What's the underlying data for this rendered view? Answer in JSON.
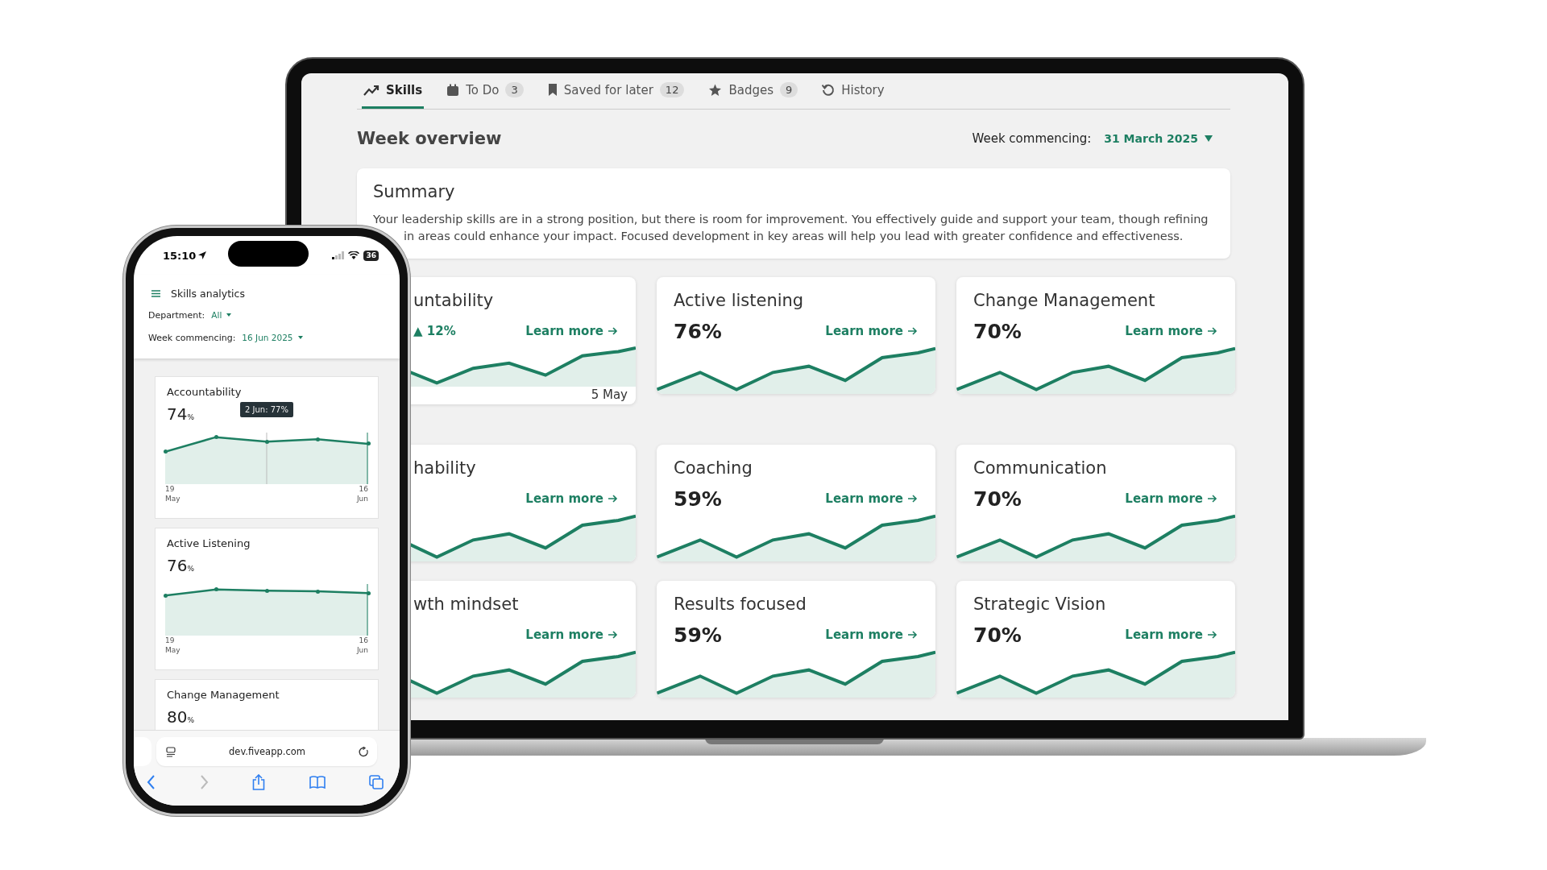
{
  "laptop": {
    "tabs": [
      {
        "label": "Skills",
        "selected": true
      },
      {
        "label": "To Do",
        "count": "3",
        "selected": false
      },
      {
        "label": "Saved for later",
        "count": "12",
        "selected": false
      },
      {
        "label": "Badges",
        "count": "9",
        "selected": false
      },
      {
        "label": "History",
        "selected": false
      }
    ],
    "heading": "Week overview",
    "week_label": "Week commencing:",
    "week_value": "31 March 2025",
    "summary": {
      "title": "Summary",
      "text": "Your leadership skills are in a strong position, but there is room for improvement. You effectively guide and support your team, though refining\nin areas could enhance your impact. Focused development in key areas will help you lead with greater confidence and effectiveness."
    },
    "skills": [
      {
        "title": "untability",
        "trend": "▲ 12%",
        "date": "5 May",
        "link": "Learn more"
      },
      {
        "title": "Active listening",
        "value": "76%",
        "link": "Learn more"
      },
      {
        "title": "Change Management",
        "value": "70%",
        "link": "Learn more"
      },
      {
        "title": "hability",
        "link": "Learn more"
      },
      {
        "title": "Coaching",
        "value": "59%",
        "link": "Learn more"
      },
      {
        "title": "Communication",
        "value": "70%",
        "link": "Learn more"
      },
      {
        "title": "wth mindset",
        "link": "Learn more"
      },
      {
        "title": "Results focused",
        "value": "59%",
        "link": "Learn more"
      },
      {
        "title": "Strategic Vision",
        "value": "70%",
        "link": "Learn more"
      }
    ]
  },
  "phone": {
    "status": {
      "time": "15:10",
      "battery": "36"
    },
    "title": "Skills analytics",
    "filters": [
      {
        "label": "Department:",
        "value": "All"
      },
      {
        "label": "Week commencing:",
        "value": "16 Jun 2025"
      }
    ],
    "cards": [
      {
        "title": "Accountability",
        "value": "74",
        "unit": "%",
        "tooltip": "2 Jun: 77%",
        "axis": {
          "start": "19\nMay",
          "end": "16\nJun"
        }
      },
      {
        "title": "Active Listening",
        "value": "76",
        "unit": "%",
        "axis": {
          "start": "19\nMay",
          "end": "16\nJun"
        }
      },
      {
        "title": "Change Management",
        "value": "80",
        "unit": "%"
      }
    ],
    "browser": {
      "url": "dev.fiveapp.com",
      "toolbar": [
        {
          "kind": "back",
          "disabled": false
        },
        {
          "kind": "forward",
          "disabled": true
        },
        {
          "kind": "share",
          "disabled": false
        },
        {
          "kind": "bookmarks",
          "disabled": false
        },
        {
          "kind": "tabs",
          "disabled": false
        }
      ]
    }
  }
}
